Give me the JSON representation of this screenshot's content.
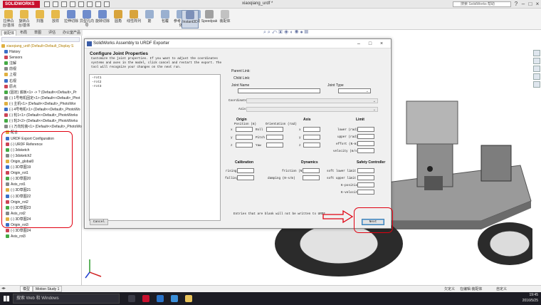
{
  "app": {
    "logo": "SOLIDWORKS",
    "window_title": "xiaoqiang_urdf *",
    "search_placeholder": "搜索 SolidWorks 帮助",
    "window_controls": [
      "?",
      "–",
      "□",
      "×"
    ]
  },
  "ribbon": {
    "buttons": [
      "拉伸凸台/基体",
      "旋转凸台/基体",
      "扫描",
      "放样",
      "拉伸切除",
      "异型孔向导",
      "旋转切除",
      "圆角",
      "线性阵列",
      "筋",
      "包覆",
      "参考几何体",
      "曲线",
      "Instant3D",
      "Speedpak",
      "装配体"
    ],
    "selected": "Instant3D"
  },
  "command_tabs": [
    "装配体",
    "布局",
    "草图",
    "评估",
    "办公室产品"
  ],
  "tree": {
    "root": "xiaoqiang_urdf  (Default<Default_Display S",
    "items": [
      "History",
      "Sensors",
      "注解",
      "前视",
      "上视",
      "右视",
      "原点",
      "(固定) 底板<1> -> ? (Default<<Default>_Pr",
      "(-) 1号电机固定<1> (Default<<Default>_Phot",
      "(-) 主机<1> (Default<<Default>_PhotoWor",
      "(-) 4号电机<1> (Default<<Default>_PhotoWo",
      "(-) 轮1<1> (Default<<Default>_PhotoWorks",
      "(-) 轮2<2> (Default<<Default>_PhotoWorks",
      "(-) 万向轮装<1> (Default<<Default>_PhotoWo",
      "配合",
      "URDF Export Configuration",
      "(-) URDF Reference",
      "(-) 3dsketch",
      "(-) 3dsketch2",
      "Origin_global0",
      "(-) 3D草图19",
      "Origin_rot1",
      "(-) 3D草图20",
      "Axis_rot1",
      "(-) 3D草图21",
      "(-) 3D草图22",
      "Origin_rot2",
      "(-) 3D草图23",
      "Axis_rot2",
      "(-) 3D草图24",
      "Origin_rot3",
      "(-) 3D草图24",
      "Axis_rot3"
    ]
  },
  "bottom_tabs": [
    "模型",
    "Motion Study 1"
  ],
  "dialog": {
    "title": "SolidWorks Assembly to URDF Exporter",
    "heading": "Configure Joint Properties",
    "instructions": [
      "Customize the joint properties. If you want to adjust the coordinates",
      "systems and axes in the model, click cancel and restart the export. The",
      "tool will recognize your changes on the next run."
    ],
    "links": [
      "rot1",
      "rot2",
      "rot3"
    ],
    "parent_link_label": "Parent Link:",
    "child_link_label": "Child Link:",
    "joint_name_label": "Joint Name",
    "joint_type_label": "Joint Type",
    "coordinates_label": "Coordinates",
    "axis_label": "Axis",
    "origin": {
      "title": "Origin",
      "position_label": "Position (m)",
      "orientation_label": "Orientation (rad)",
      "axes": [
        "x",
        "y",
        "z"
      ],
      "angles": [
        "Roll",
        "Pitch",
        "Yaw"
      ]
    },
    "axis_section": {
      "title": "Axis",
      "axes": [
        "x",
        "y",
        "z"
      ]
    },
    "limit": {
      "title": "Limit",
      "fields": [
        "lower (rad)",
        "upper (rad)",
        "effort (N-m)",
        "velocity (m/s)"
      ]
    },
    "calibration": {
      "title": "Calibration",
      "fields": [
        "rising",
        "falling"
      ]
    },
    "dynamics": {
      "title": "Dynamics",
      "fields": [
        "friction (N)",
        "damping (N-s/m)"
      ]
    },
    "safety": {
      "title": "Safety Controller",
      "fields": [
        "soft lower limit",
        "soft upper limit",
        "K-position",
        "K-velocity"
      ]
    },
    "note": "Entries that are blank will not be written to URDF",
    "cancel_label": "Cancel",
    "next_label": "Next"
  },
  "statusbar": {
    "left": "",
    "right": [
      "欠定义",
      "在编辑 装配体",
      "自定义"
    ]
  },
  "taskbar": {
    "search_placeholder": "搜索 Web 和 Windows",
    "time": "19:45",
    "date": "2016/5/25"
  },
  "annotation_color": "#e00010"
}
